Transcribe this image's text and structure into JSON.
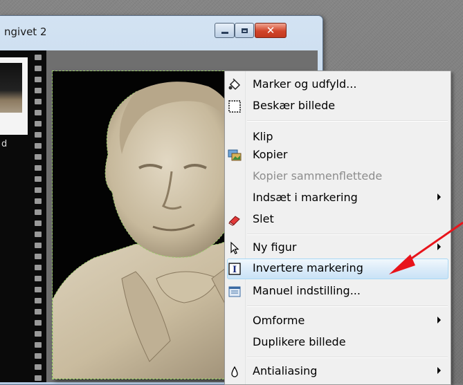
{
  "window": {
    "title": "ngivet 2",
    "thumbnail_label": "d"
  },
  "menu": {
    "items": [
      {
        "label": "Marker og udfyld...",
        "icon": "paint-bucket-icon",
        "disabled": false,
        "submenu": false
      },
      {
        "label": "Beskær billede",
        "icon": "crop-icon",
        "disabled": false,
        "submenu": false
      },
      {
        "label": "Klip",
        "icon": "",
        "disabled": false,
        "submenu": false
      },
      {
        "label": "Kopier",
        "icon": "copy-image-icon",
        "disabled": false,
        "submenu": false
      },
      {
        "label": "Kopier sammenflettede",
        "icon": "",
        "disabled": true,
        "submenu": false
      },
      {
        "label": "Indsæt i markering",
        "icon": "",
        "disabled": false,
        "submenu": true
      },
      {
        "label": "Slet",
        "icon": "eraser-icon",
        "disabled": false,
        "submenu": false
      },
      {
        "label": "Ny figur",
        "icon": "pointer-icon",
        "disabled": false,
        "submenu": true
      },
      {
        "label": "Invertere markering",
        "icon": "invert-selection-icon",
        "disabled": false,
        "submenu": false,
        "highlighted": true
      },
      {
        "label": "Manuel indstilling...",
        "icon": "manual-settings-icon",
        "disabled": false,
        "submenu": false
      },
      {
        "label": "Omforme",
        "icon": "",
        "disabled": false,
        "submenu": true
      },
      {
        "label": "Duplikere billede",
        "icon": "",
        "disabled": false,
        "submenu": false
      },
      {
        "label": "Antialiasing",
        "icon": "droplet-icon",
        "disabled": false,
        "submenu": true
      }
    ]
  },
  "colors": {
    "annotation_arrow": "#e8141b",
    "menu_highlight": "#c9e2f6",
    "selection_marquee": "#9acb6a"
  }
}
